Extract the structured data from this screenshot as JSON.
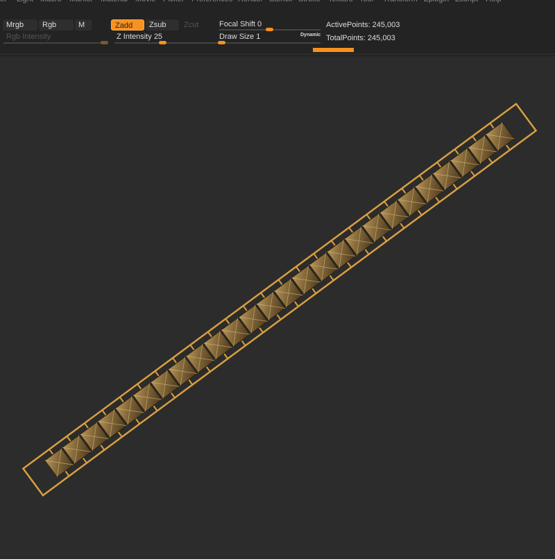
{
  "menu": [
    "er",
    "Light",
    "Macro",
    "Marker",
    "Material",
    "Movie",
    "Picker",
    "Preferences",
    "Render",
    "Stencil",
    "Stroke",
    "Texture",
    "Tool",
    "Transform",
    "Zplugin",
    "Zscript",
    "Help"
  ],
  "toolbar": {
    "mrgb": "Mrgb",
    "rgb": "Rgb",
    "m": "M",
    "zadd": "Zadd",
    "zsub": "Zsub",
    "zcut": "Zcut",
    "rgb_intensity": "Rgb Intensity",
    "z_intensity_label": "Z Intensity",
    "z_intensity": "25",
    "focal_shift_label": "Focal Shift",
    "focal_shift": "0",
    "draw_size_label": "Draw Size",
    "draw_size": "1",
    "dynamic": "Dynamic",
    "active_points": "ActivePoints: 245,003",
    "total_points": "TotalPoints: 245,003"
  },
  "colors": {
    "accent": "#f7911f",
    "frame": "#d9a040",
    "stud": "#8a6e3c"
  },
  "model": {
    "stud_count": 26
  }
}
